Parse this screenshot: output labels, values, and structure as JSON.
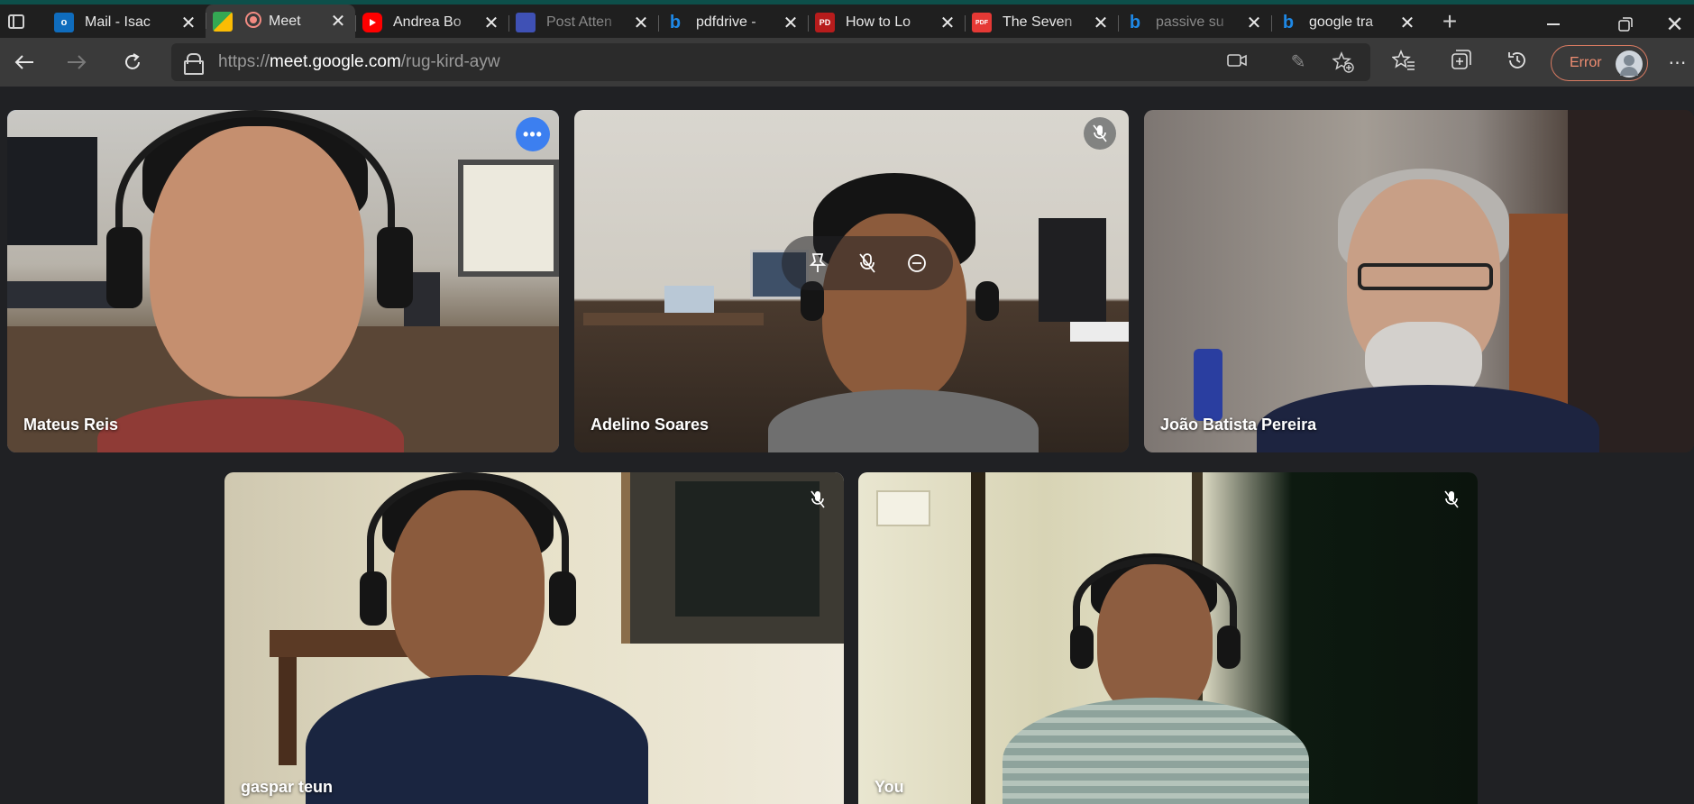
{
  "tabs": [
    {
      "title": "Mail - Isac",
      "icon": "outlook-icon",
      "color": "#0f6cbd",
      "active": false,
      "dim": false
    },
    {
      "title": "Meet",
      "icon": "meet-icon",
      "color": "#00897b",
      "active": true,
      "dim": false
    },
    {
      "title": "Andrea Bo",
      "icon": "youtube-icon",
      "color": "#ff0000",
      "active": false,
      "dim": false
    },
    {
      "title": "Post Atten",
      "icon": "doc-icon",
      "color": "#3f51b5",
      "active": false,
      "dim": true
    },
    {
      "title": "pdfdrive -",
      "icon": "bing-icon",
      "color": "#1e88e5",
      "active": false,
      "dim": false
    },
    {
      "title": "How to Lo",
      "icon": "pdf-icon",
      "color": "#b71c1c",
      "active": false,
      "dim": false
    },
    {
      "title": "The Seven",
      "icon": "pdf-reader-icon",
      "color": "#e53935",
      "active": false,
      "dim": false
    },
    {
      "title": "passive su",
      "icon": "bing-icon",
      "color": "#1e88e5",
      "active": false,
      "dim": true
    },
    {
      "title": "google tra",
      "icon": "bing-icon",
      "color": "#1e88e5",
      "active": false,
      "dim": false
    }
  ],
  "address": {
    "scheme": "https://",
    "host": "meet.google.com",
    "path": "/rug-kird-ayw"
  },
  "profile": {
    "label": "Error"
  },
  "participants": {
    "mateus": {
      "name": "Mateus Reis"
    },
    "adelino": {
      "name": "Adelino Soares"
    },
    "joao": {
      "name": "João Batista Pereira"
    },
    "gaspar": {
      "name": "gaspar teun"
    },
    "you": {
      "name": "You"
    }
  },
  "colors": {
    "accent": "#8ab4f8",
    "background": "#202124",
    "more_button": "#3c7ff0",
    "profile_error": "#f08e72"
  }
}
